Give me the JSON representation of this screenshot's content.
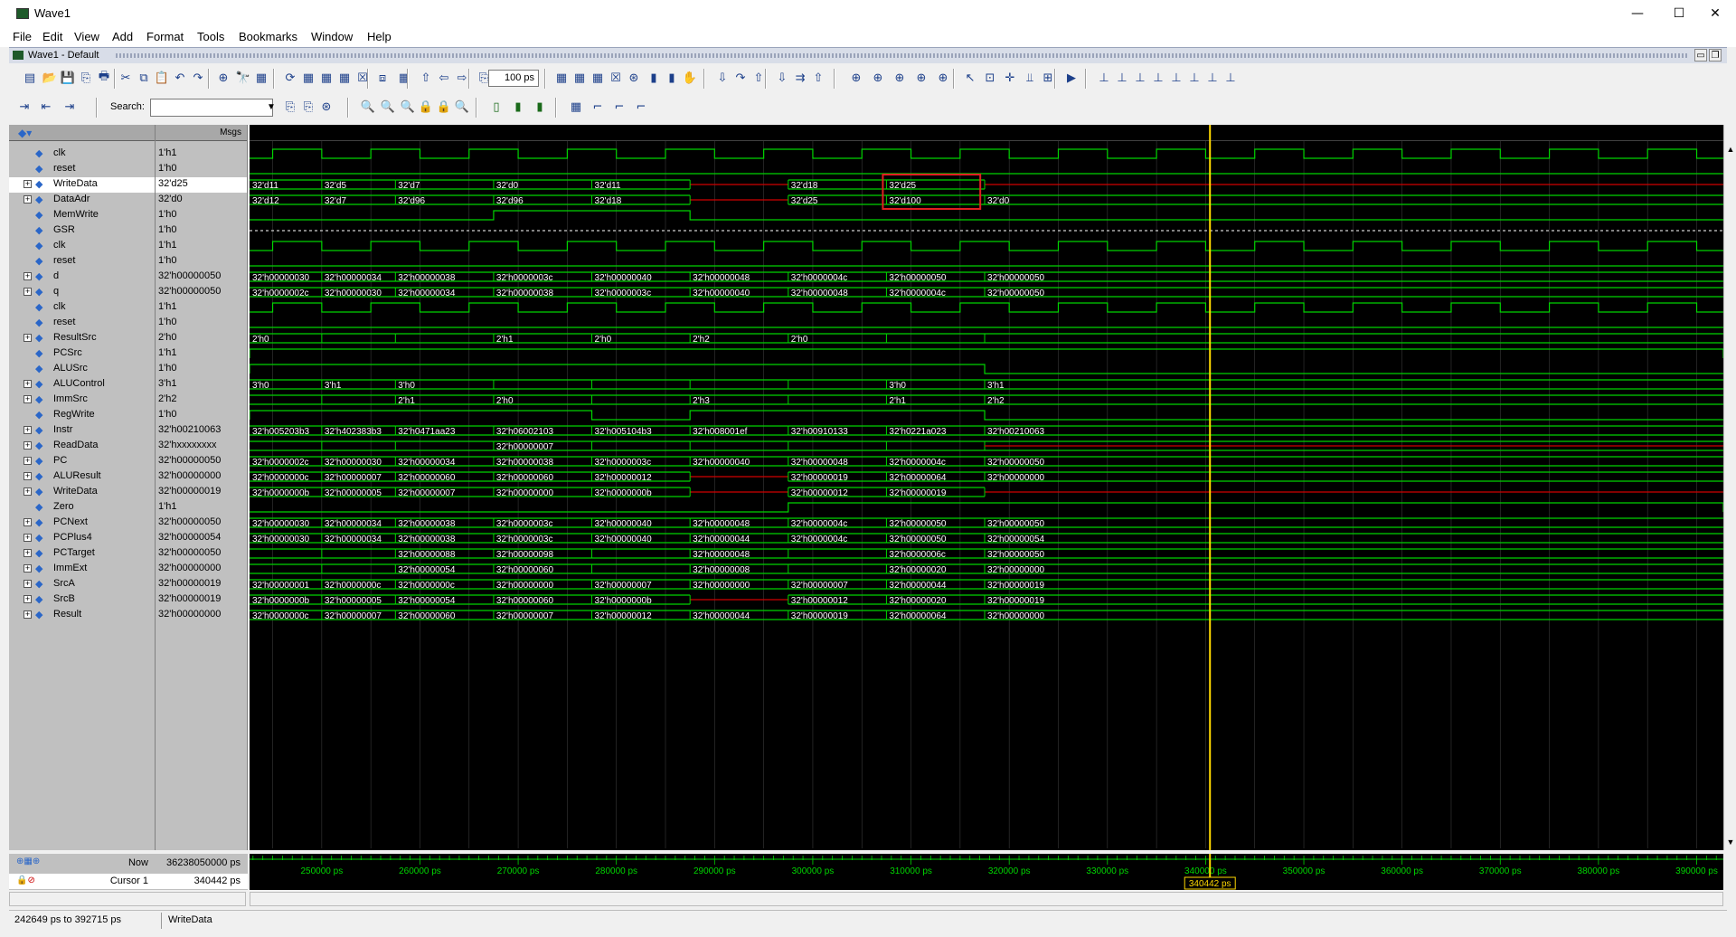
{
  "window": {
    "title": "Wave1",
    "minimize": "—",
    "maximize": "☐",
    "close": "✕"
  },
  "menu": [
    "File",
    "Edit",
    "View",
    "Add",
    "Format",
    "Tools",
    "Bookmarks",
    "Window",
    "Help"
  ],
  "subwindow": {
    "title": "Wave1 - Default"
  },
  "toolbar": {
    "zoom_value": "100",
    "zoom_unit": "ps",
    "search_label": "Search:",
    "search_value": ""
  },
  "panes": {
    "msgs_header": "Msgs"
  },
  "colors": {
    "wave": "#00d400",
    "value_text": "#ffffff",
    "cursor": "#ffd800",
    "highlight_box": "#e02020",
    "undefined": "#d00000"
  },
  "signals": [
    {
      "name": "clk",
      "value": "1'h1",
      "expandable": false,
      "kind": "clock",
      "waves": []
    },
    {
      "name": "reset",
      "value": "1'h0",
      "expandable": false,
      "kind": "low",
      "waves": []
    },
    {
      "name": "WriteData",
      "value": "32'd25",
      "expandable": true,
      "selected": true,
      "kind": "bus",
      "waves": [
        "32'd11",
        "32'd5",
        "32'd7",
        "32'd0",
        "32'd11",
        "",
        "32'd18",
        "32'd25",
        ""
      ]
    },
    {
      "name": "DataAdr",
      "value": "32'd0",
      "expandable": true,
      "kind": "bus",
      "waves": [
        "32'd12",
        "32'd7",
        "32'd96",
        "32'd96",
        "32'd18",
        "",
        "32'd25",
        "32'd100",
        "32'd0"
      ]
    },
    {
      "name": "MemWrite",
      "value": "1'h0",
      "expandable": false,
      "kind": "memwrite",
      "waves": []
    },
    {
      "name": "GSR",
      "value": "1'h0",
      "expandable": false,
      "kind": "dashed",
      "waves": []
    },
    {
      "name": "clk",
      "value": "1'h1",
      "expandable": false,
      "kind": "clock",
      "waves": []
    },
    {
      "name": "reset",
      "value": "1'h0",
      "expandable": false,
      "kind": "low",
      "waves": []
    },
    {
      "name": "d",
      "value": "32'h00000050",
      "expandable": true,
      "kind": "bus",
      "waves": [
        "32'h00000030",
        "32'h00000034",
        "32'h00000038",
        "32'h0000003c",
        "32'h00000040",
        "32'h00000048",
        "32'h0000004c",
        "32'h00000050",
        "32'h00000050"
      ]
    },
    {
      "name": "q",
      "value": "32'h00000050",
      "expandable": true,
      "kind": "bus",
      "waves": [
        "32'h0000002c",
        "32'h00000030",
        "32'h00000034",
        "32'h00000038",
        "32'h0000003c",
        "32'h00000040",
        "32'h00000048",
        "32'h0000004c",
        "32'h00000050"
      ]
    },
    {
      "name": "clk",
      "value": "1'h1",
      "expandable": false,
      "kind": "clock",
      "waves": []
    },
    {
      "name": "reset",
      "value": "1'h0",
      "expandable": false,
      "kind": "low",
      "waves": []
    },
    {
      "name": "ResultSrc",
      "value": "2'h0",
      "expandable": true,
      "kind": "bus",
      "waves": [
        "2'h0",
        "",
        "",
        "2'h1",
        "2'h0",
        "2'h2",
        "2'h0",
        "",
        ""
      ]
    },
    {
      "name": "PCSrc",
      "value": "1'h1",
      "expandable": false,
      "kind": "pcsrc",
      "waves": []
    },
    {
      "name": "ALUSrc",
      "value": "1'h0",
      "expandable": false,
      "kind": "alusrc",
      "waves": []
    },
    {
      "name": "ALUControl",
      "value": "3'h1",
      "expandable": true,
      "kind": "bus",
      "waves": [
        "3'h0",
        "3'h1",
        "3'h0",
        "",
        "",
        "",
        "",
        "3'h0",
        "3'h1"
      ]
    },
    {
      "name": "ImmSrc",
      "value": "2'h2",
      "expandable": true,
      "kind": "bus",
      "waves": [
        "",
        "",
        "2'h1",
        "2'h0",
        "",
        "2'h3",
        "",
        "2'h1",
        "2'h2"
      ]
    },
    {
      "name": "RegWrite",
      "value": "1'h0",
      "expandable": false,
      "kind": "regwrite",
      "waves": []
    },
    {
      "name": "Instr",
      "value": "32'h00210063",
      "expandable": true,
      "kind": "bus",
      "waves": [
        "32'h005203b3",
        "32'h402383b3",
        "32'h0471aa23",
        "32'h06002103",
        "32'h005104b3",
        "32'h008001ef",
        "32'h00910133",
        "32'h0221a023",
        "32'h00210063"
      ]
    },
    {
      "name": "ReadData",
      "value": "32'hxxxxxxxx",
      "expandable": true,
      "kind": "bus",
      "waves": [
        "",
        "",
        "",
        "32'h00000007",
        "",
        "",
        "",
        "",
        ""
      ]
    },
    {
      "name": "PC",
      "value": "32'h00000050",
      "expandable": true,
      "kind": "bus",
      "waves": [
        "32'h0000002c",
        "32'h00000030",
        "32'h00000034",
        "32'h00000038",
        "32'h0000003c",
        "32'h00000040",
        "32'h00000048",
        "32'h0000004c",
        "32'h00000050"
      ]
    },
    {
      "name": "ALUResult",
      "value": "32'h00000000",
      "expandable": true,
      "kind": "bus",
      "waves": [
        "32'h0000000c",
        "32'h00000007",
        "32'h00000060",
        "32'h00000060",
        "32'h00000012",
        "",
        "32'h00000019",
        "32'h00000064",
        "32'h00000000"
      ]
    },
    {
      "name": "WriteData",
      "value": "32'h00000019",
      "expandable": true,
      "kind": "bus",
      "waves": [
        "32'h0000000b",
        "32'h00000005",
        "32'h00000007",
        "32'h00000000",
        "32'h0000000b",
        "",
        "32'h00000012",
        "32'h00000019",
        ""
      ]
    },
    {
      "name": "Zero",
      "value": "1'h1",
      "expandable": false,
      "kind": "zero",
      "waves": []
    },
    {
      "name": "PCNext",
      "value": "32'h00000050",
      "expandable": true,
      "kind": "bus",
      "waves": [
        "32'h00000030",
        "32'h00000034",
        "32'h00000038",
        "32'h0000003c",
        "32'h00000040",
        "32'h00000048",
        "32'h0000004c",
        "32'h00000050",
        "32'h00000050"
      ]
    },
    {
      "name": "PCPlus4",
      "value": "32'h00000054",
      "expandable": true,
      "kind": "bus",
      "waves": [
        "32'h00000030",
        "32'h00000034",
        "32'h00000038",
        "32'h0000003c",
        "32'h00000040",
        "32'h00000044",
        "32'h0000004c",
        "32'h00000050",
        "32'h00000054"
      ]
    },
    {
      "name": "PCTarget",
      "value": "32'h00000050",
      "expandable": true,
      "kind": "bus",
      "waves": [
        "",
        "",
        "32'h00000088",
        "32'h00000098",
        "",
        "32'h00000048",
        "",
        "32'h0000006c",
        "32'h00000050"
      ]
    },
    {
      "name": "ImmExt",
      "value": "32'h00000000",
      "expandable": true,
      "kind": "bus",
      "waves": [
        "",
        "",
        "32'h00000054",
        "32'h00000060",
        "",
        "32'h00000008",
        "",
        "32'h00000020",
        "32'h00000000"
      ]
    },
    {
      "name": "SrcA",
      "value": "32'h00000019",
      "expandable": true,
      "kind": "bus",
      "waves": [
        "32'h00000001",
        "32'h0000000c",
        "32'h0000000c",
        "32'h00000000",
        "32'h00000007",
        "32'h00000000",
        "32'h00000007",
        "32'h00000044",
        "32'h00000019"
      ]
    },
    {
      "name": "SrcB",
      "value": "32'h00000019",
      "expandable": true,
      "kind": "bus",
      "waves": [
        "32'h0000000b",
        "32'h00000005",
        "32'h00000054",
        "32'h00000060",
        "32'h0000000b",
        "",
        "32'h00000012",
        "32'h00000020",
        "32'h00000019"
      ]
    },
    {
      "name": "Result",
      "value": "32'h00000000",
      "expandable": true,
      "kind": "bus",
      "waves": [
        "32'h0000000c",
        "32'h00000007",
        "32'h00000060",
        "32'h00000007",
        "32'h00000012",
        "32'h00000044",
        "32'h00000019",
        "32'h00000064",
        "32'h00000000"
      ]
    }
  ],
  "timeline": {
    "ticks": [
      "250000 ps",
      "260000 ps",
      "270000 ps",
      "280000 ps",
      "290000 ps",
      "300000 ps",
      "310000 ps",
      "320000 ps",
      "330000 ps",
      "340000 ps",
      "350000 ps",
      "360000 ps",
      "370000 ps",
      "380000 ps",
      "390000 ps"
    ],
    "view_start_ps": 242649,
    "view_end_ps": 392715
  },
  "bottom": {
    "now_label": "Now",
    "now_value": "36238050000 ps",
    "cursor_label": "Cursor 1",
    "cursor_value": "340442 ps",
    "cursor_flag": "340442 ps"
  },
  "status": {
    "range": "242649 ps to 392715 ps",
    "selected_signal": "WriteData"
  }
}
